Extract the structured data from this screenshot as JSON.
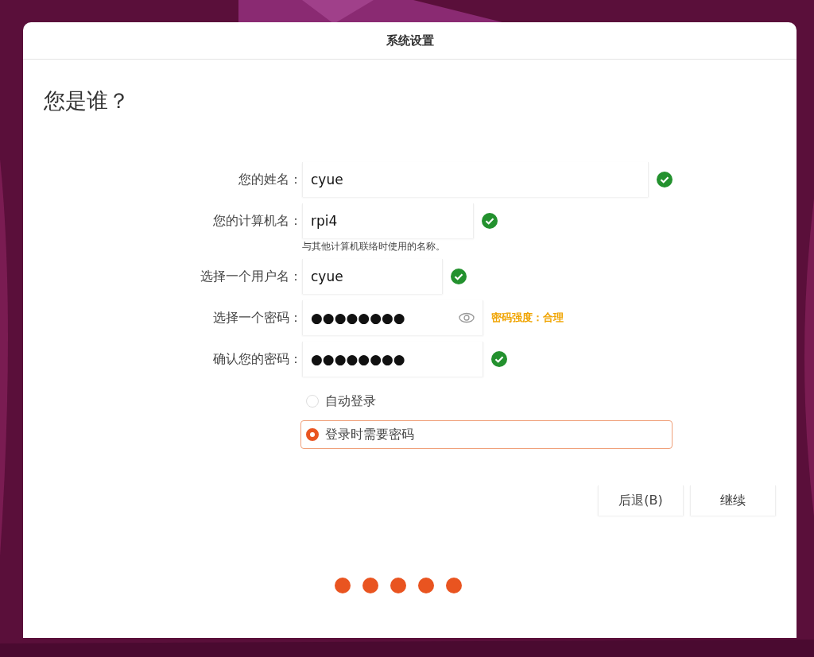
{
  "window": {
    "title": "系统设置"
  },
  "heading": "您是谁？",
  "fields": [
    {
      "kind": "valid",
      "label": "您的姓名：",
      "value": "cyue",
      "reveal_icon": false
    },
    {
      "kind": "valid",
      "label": "您的计算机名：",
      "value": "rpi4",
      "reveal_icon": false,
      "hint": "与其他计算机联络时使用的名称。"
    },
    {
      "kind": "valid",
      "label": "选择一个用户名：",
      "value": "cyue",
      "reveal_icon": false
    },
    {
      "kind": "strength",
      "label": "选择一个密码：",
      "value": "●●●●●●●●",
      "strength_text": "密码强度：合理",
      "reveal_icon": true
    },
    {
      "kind": "valid",
      "label": "确认您的密码：",
      "value": "●●●●●●●●",
      "reveal_icon": false
    }
  ],
  "login_options": [
    {
      "label": "自动登录",
      "selected": false
    },
    {
      "label": "登录时需要密码",
      "selected": true
    }
  ],
  "buttons": [
    {
      "label": "后退(B)"
    },
    {
      "label": "继续"
    }
  ],
  "progress_steps": [
    {
      "done": true
    },
    {
      "done": true
    },
    {
      "done": true
    },
    {
      "done": true
    },
    {
      "done": true
    }
  ]
}
